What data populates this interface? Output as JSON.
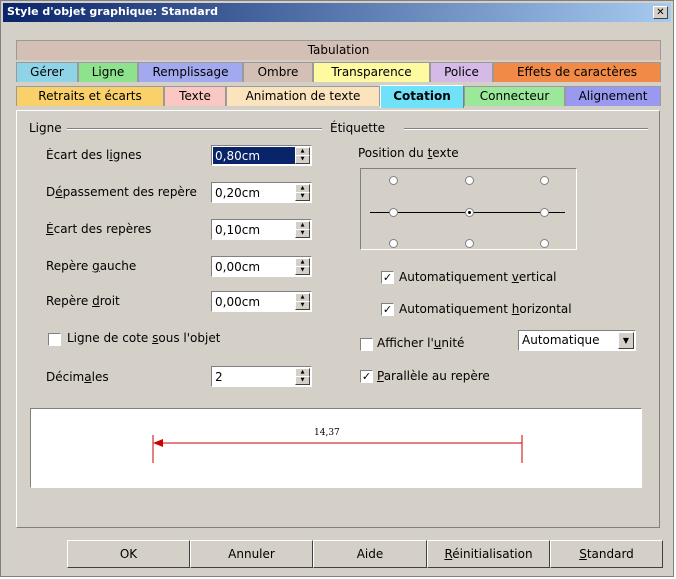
{
  "window": {
    "title": "Style d'objet graphique: Standard",
    "close_glyph": "✕"
  },
  "tabs": {
    "row1": [
      {
        "label": "Tabulation",
        "color": "#d4bfb5"
      }
    ],
    "row2": [
      {
        "label": "Gérer",
        "color": "#8fd3e6"
      },
      {
        "label": "Ligne",
        "color": "#8ee28e"
      },
      {
        "label": "Remplissage",
        "color": "#a3a9ef"
      },
      {
        "label": "Ombre",
        "color": "#d4bfb5"
      },
      {
        "label": "Transparence",
        "color": "#fdfaa0"
      },
      {
        "label": "Police",
        "color": "#d5b9e7"
      },
      {
        "label": "Effets de caractères",
        "color": "#f08a46"
      }
    ],
    "row3": [
      {
        "label": "Retraits et écarts",
        "color": "#f9d06a"
      },
      {
        "label": "Texte",
        "color": "#fbc7c2"
      },
      {
        "label": "Animation de texte",
        "color": "#fbe3bd"
      },
      {
        "label": "Cotation",
        "color": "#6fe1f8",
        "active": true
      },
      {
        "label": "Connecteur",
        "color": "#9be89b"
      },
      {
        "label": "Alignement",
        "color": "#9a99f0"
      }
    ]
  },
  "ligne": {
    "group_label": "Ligne",
    "ecart_lignes": {
      "pre": "Écart des l",
      "u": "i",
      "post": "gnes",
      "value": "0,80cm"
    },
    "depassement": {
      "pre": "D",
      "u": "é",
      "post": "passement des repère",
      "value": "0,20cm"
    },
    "ecart_reperes": {
      "pre": "",
      "u": "É",
      "post": "cart des repères",
      "value": "0,10cm"
    },
    "repere_gauche": {
      "pre": "Repère ",
      "u": "g",
      "post": "auche",
      "value": "0,00cm"
    },
    "repere_droit": {
      "pre": "Repère ",
      "u": "d",
      "post": "roit",
      "value": "0,00cm"
    },
    "sous_objet": {
      "pre": "Ligne de cote ",
      "u": "s",
      "post": "ous l'objet",
      "checked": false
    },
    "decimales": {
      "pre": "Décim",
      "u": "a",
      "post": "les",
      "value": "2"
    }
  },
  "etiquette": {
    "group_label": "Étiquette",
    "position": {
      "pre": "Position du ",
      "u": "t",
      "post": "exte"
    },
    "auto_vertical": {
      "pre": "Automatiquement ",
      "u": "v",
      "post": "ertical",
      "checked": true
    },
    "auto_horizontal": {
      "pre": "Automatiquement ",
      "u": "h",
      "post": "orizontal",
      "checked": true
    },
    "afficher_unite": {
      "pre": "Afficher l'",
      "u": "u",
      "post": "nité",
      "checked": false
    },
    "unit_select": {
      "value": "Automatique"
    },
    "parallele": {
      "pre": "",
      "u": "P",
      "post": "arallèle au repère",
      "checked": true
    }
  },
  "preview": {
    "dimension_value": "14,37",
    "line_color": "#cc0000"
  },
  "buttons": {
    "ok": "OK",
    "annuler": "Annuler",
    "aide": "Aide",
    "reinit": {
      "pre": "",
      "u": "R",
      "post": "éinitialisation"
    },
    "standard": {
      "pre": "",
      "u": "S",
      "post": "tandard"
    }
  }
}
